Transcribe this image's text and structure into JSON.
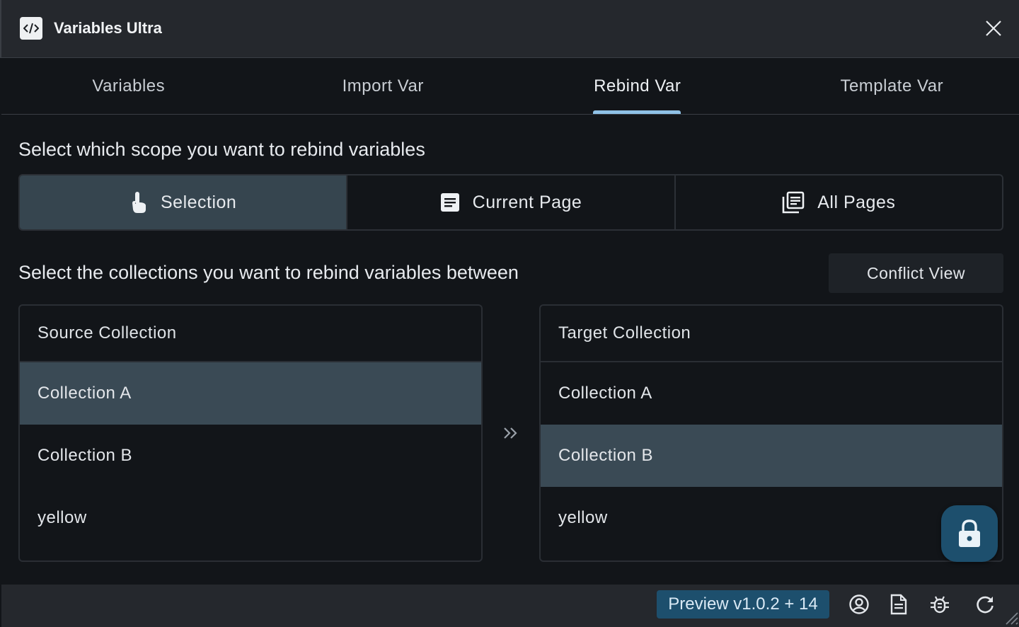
{
  "app": {
    "title": "Variables Ultra",
    "icon": "code-icon"
  },
  "tabs": [
    {
      "label": "Variables",
      "active": false
    },
    {
      "label": "Import Var",
      "active": false
    },
    {
      "label": "Rebind Var",
      "active": true
    },
    {
      "label": "Template Var",
      "active": false
    }
  ],
  "scope": {
    "prompt": "Select which scope you want to rebind variables",
    "options": [
      {
        "label": "Selection",
        "icon": "touch-icon",
        "active": true
      },
      {
        "label": "Current Page",
        "icon": "page-icon",
        "active": false
      },
      {
        "label": "All Pages",
        "icon": "pages-icon",
        "active": false
      }
    ]
  },
  "collections": {
    "prompt": "Select the collections you want to rebind variables between",
    "conflict_button": "Conflict View",
    "source": {
      "header": "Source Collection",
      "items": [
        "Collection A",
        "Collection B",
        "yellow"
      ],
      "selected": "Collection A"
    },
    "target": {
      "header": "Target Collection",
      "items": [
        "Collection A",
        "Collection B",
        "yellow"
      ],
      "selected": "Collection B"
    }
  },
  "footer": {
    "version": "Preview v1.0.2 + 14",
    "icons": [
      "account-icon",
      "docs-icon",
      "bug-icon",
      "refresh-icon"
    ]
  },
  "colors": {
    "accent": "#8fc1e6",
    "selected_bg": "#3a4a55",
    "badge_bg": "#1d4f6d",
    "background": "#121519",
    "chrome": "#25282d"
  }
}
